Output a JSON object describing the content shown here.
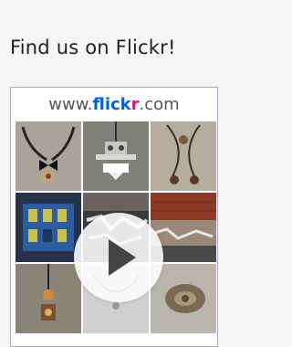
{
  "heading": "Find us on Flickr!",
  "brand": {
    "www": "www.",
    "flick": "flick",
    "r": "r",
    "com": ".com"
  },
  "photos": [
    "necklace-with-bow",
    "pendant-keys",
    "long-chain-necklace",
    "blue-door-print",
    "graffiti-wall",
    "brick-wall",
    "amber-pendant",
    "silver-chain",
    "filigree-brooch"
  ],
  "colors": {
    "border": "#b9a3c9",
    "flickr_blue": "#0063dc",
    "flickr_pink": "#ff0084"
  }
}
